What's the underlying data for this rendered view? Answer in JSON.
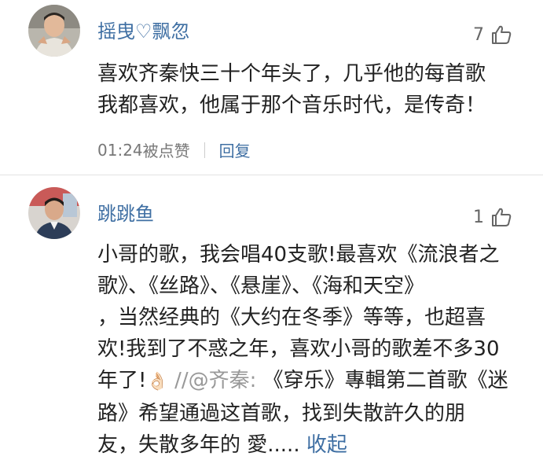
{
  "comments": [
    {
      "username": "摇曳♡飘忽",
      "likes": "7",
      "content_lines": [
        "喜欢齐秦快三十个年头了，几乎他的每首歌",
        "我都喜欢，他属于那个音乐时代，是传奇！"
      ],
      "time": "01:24",
      "liked_by": "被点赞",
      "reply_label": "回复"
    },
    {
      "username": "跳跳鱼",
      "likes": "1",
      "content_lines": [
        "小哥的歌，我会唱40支歌!最喜欢《流浪者之",
        "歌》、《丝路》、《悬崖》、《海和天空》",
        "，当然经典的《大约在冬季》等等，也超喜",
        "欢!我到了不惑之年，喜欢小哥的歌差不多30"
      ],
      "line5_prefix": "年了!",
      "line5_emoji": "👌🏻",
      "line5_quote": " //@齐秦: ",
      "line5_rest": "《穿乐》專輯第二首歌《迷",
      "content_lines_after": [
        "路》希望通過这首歌，找到失散許久的朋"
      ],
      "last_line_text": "友，失散多年的 愛.....",
      "collapse_label": "收起"
    }
  ]
}
